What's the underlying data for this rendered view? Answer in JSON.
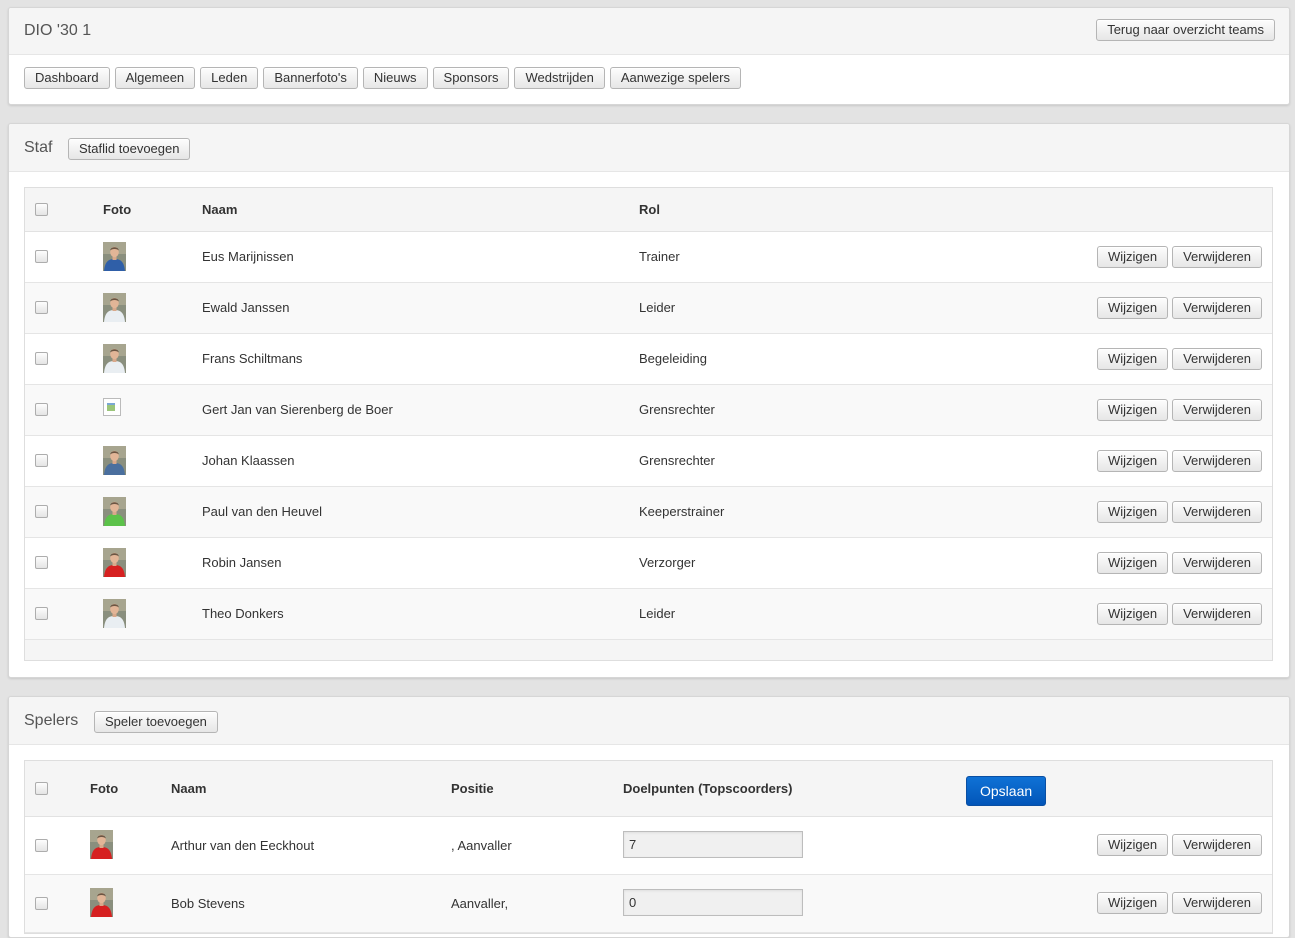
{
  "header": {
    "title": "DIO '30 1",
    "back_label": "Terug naar overzicht teams",
    "nav": [
      "Dashboard",
      "Algemeen",
      "Leden",
      "Bannerfoto's",
      "Nieuws",
      "Sponsors",
      "Wedstrijden",
      "Aanwezige spelers"
    ]
  },
  "staff": {
    "title": "Staf",
    "add_label": "Staflid toevoegen",
    "columns": {
      "photo": "Foto",
      "name": "Naam",
      "role": "Rol"
    },
    "edit_label": "Wijzigen",
    "delete_label": "Verwijderen",
    "rows": [
      {
        "name": "Eus Marijnissen",
        "role": "Trainer",
        "shirt": "#2f5fa8",
        "photo": true
      },
      {
        "name": "Ewald Janssen",
        "role": "Leider",
        "shirt": "#e9eef2",
        "photo": true
      },
      {
        "name": "Frans Schiltmans",
        "role": "Begeleiding",
        "shirt": "#e9eef2",
        "photo": true
      },
      {
        "name": "Gert Jan van Sierenberg de Boer",
        "role": "Grensrechter",
        "shirt": "",
        "photo": false
      },
      {
        "name": "Johan Klaassen",
        "role": "Grensrechter",
        "shirt": "#4a6f9e",
        "photo": true
      },
      {
        "name": "Paul van den Heuvel",
        "role": "Keeperstrainer",
        "shirt": "#5cc24a",
        "photo": true
      },
      {
        "name": "Robin Jansen",
        "role": "Verzorger",
        "shirt": "#d62020",
        "photo": true
      },
      {
        "name": "Theo Donkers",
        "role": "Leider",
        "shirt": "#e9eef2",
        "photo": true
      }
    ]
  },
  "players": {
    "title": "Spelers",
    "add_label": "Speler toevoegen",
    "columns": {
      "photo": "Foto",
      "name": "Naam",
      "position": "Positie",
      "goals": "Doelpunten (Topscoorders)"
    },
    "save_label": "Opslaan",
    "edit_label": "Wijzigen",
    "delete_label": "Verwijderen",
    "rows": [
      {
        "name": "Arthur van den Eeckhout",
        "position": ", Aanvaller",
        "goals": "7",
        "shirt": "#d62020"
      },
      {
        "name": "Bob Stevens",
        "position": "Aanvaller,",
        "goals": "0",
        "shirt": "#d62020"
      }
    ]
  },
  "colors": {
    "primary": "#0a5fc7",
    "background": "#e3e3e3"
  }
}
